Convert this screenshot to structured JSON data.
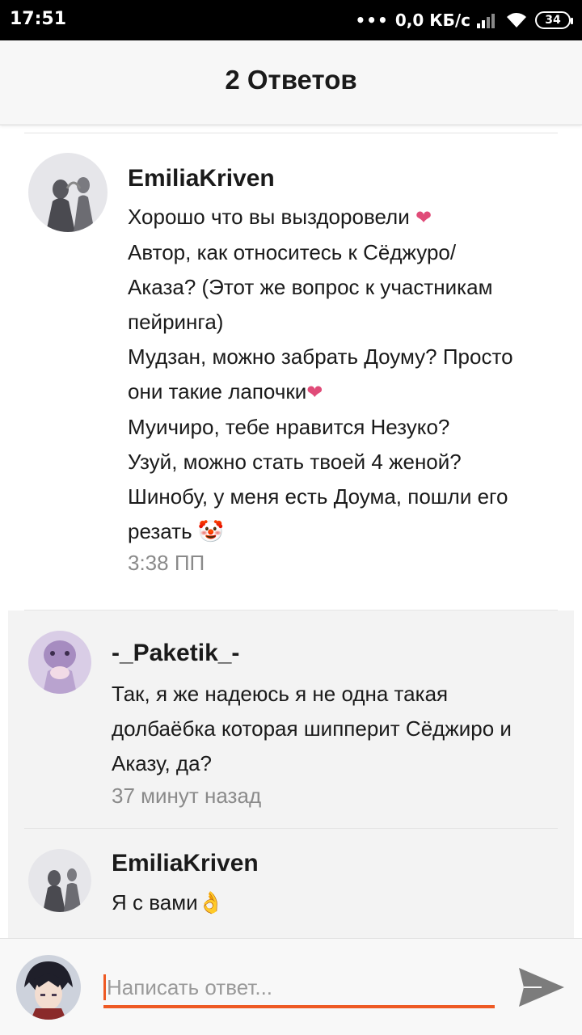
{
  "status_bar": {
    "time": "17:51",
    "dots": "•••",
    "network_speed": "0,0 КБ/с",
    "battery": "34"
  },
  "header": {
    "title": "2 Ответов"
  },
  "comments": [
    {
      "author": "EmiliaKriven",
      "lines": [
        "Хорошо что вы выздоровели",
        "Автор, как относитесь к  Сёджуро/",
        "Аказа? (Этот же вопрос к участникам",
        "пейринга)",
        "Мудзан, можно забрать Доуму? Просто",
        "они такие лапочки",
        "Муичиро, тебе нравится Незуко?",
        "Узуй, можно стать твоей 4 женой?",
        "Шинобу, у меня есть Доума, пошли его",
        "резать"
      ],
      "time": "3:38 ПП"
    },
    {
      "author": "-_Paketik_-",
      "lines": [
        "Так, я же надеюсь я не одна такая",
        "долбаёбка которая шипперит Сёджиро и",
        "Аказу, да?"
      ],
      "time": "37 минут назад"
    },
    {
      "author": "EmiliaKriven",
      "lines": [
        "Я с вами"
      ]
    }
  ],
  "emoji": {
    "heart": "❤",
    "clown": "🤡",
    "ok_hand": "👌"
  },
  "compose": {
    "placeholder": "Написать ответ..."
  },
  "colors": {
    "accent": "#ee5a24",
    "heart": "#e04b78",
    "timestamp": "#8a8a8a"
  }
}
